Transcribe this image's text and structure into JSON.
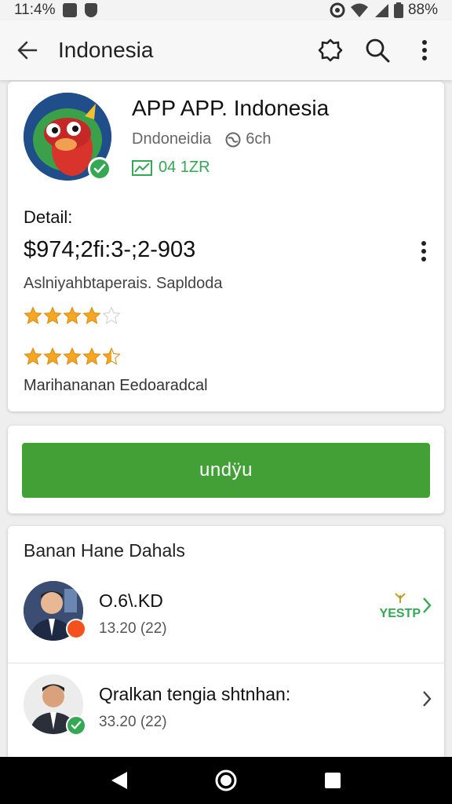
{
  "status_bar": {
    "time": "11:4%",
    "battery": "88%",
    "icons": [
      "box-icon",
      "shield-icon",
      "circle-icon",
      "wifi-icon",
      "signal-icon",
      "battery-icon"
    ]
  },
  "app_bar": {
    "title": "Indonesia",
    "icons": [
      "back-arrow-icon",
      "badge-icon",
      "search-icon",
      "more-vert-icon"
    ]
  },
  "app_card": {
    "title": "APP APP. Indonesia",
    "developer": "Dndoneidia",
    "sub_info": "6ch",
    "stat": "04 1ZR",
    "detail_label": "Detail:",
    "price": "$974;2fi:3-;2-903",
    "description": "Aslniyahbtaperais. Sapldoda",
    "rating_1": 4,
    "rating_2": 4.5,
    "maintainer": "Marihananan Eedoaradcal"
  },
  "download": {
    "label": "undÿu"
  },
  "section": {
    "title": "Banan Hane Dahals",
    "items": [
      {
        "name": "O.6\\.KD",
        "sub": "13.20 (22)",
        "badge": "YESTP"
      },
      {
        "name": "Qralkan tengia shtnhan:",
        "sub": "33.20 (22)"
      }
    ]
  },
  "colors": {
    "accent_green": "#43a036",
    "verified_green": "#34a853",
    "star_orange": "#f5a623",
    "badge_orange": "#f4511e"
  },
  "nav_bar": {
    "icons": [
      "back-triangle-icon",
      "home-circle-icon",
      "recents-square-icon"
    ]
  }
}
